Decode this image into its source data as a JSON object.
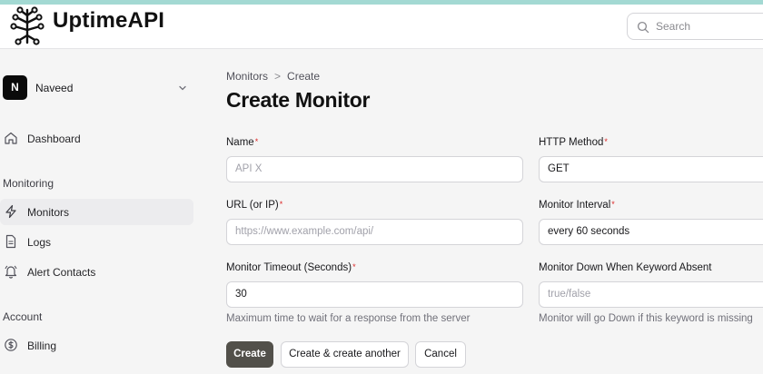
{
  "app": {
    "name": "UptimeAPI"
  },
  "search": {
    "placeholder": "Search"
  },
  "team": {
    "initial": "N",
    "name": "Naveed"
  },
  "sidebar": {
    "dashboard_label": "Dashboard",
    "monitoring_heading": "Monitoring",
    "monitors_label": "Monitors",
    "logs_label": "Logs",
    "alert_contacts_label": "Alert Contacts",
    "account_heading": "Account",
    "billing_label": "Billing"
  },
  "breadcrumb": {
    "parent": "Monitors",
    "separator": ">",
    "current": "Create"
  },
  "page": {
    "title": "Create Monitor"
  },
  "form": {
    "required_mark": "*",
    "name": {
      "label": "Name",
      "placeholder": "API X",
      "required": true
    },
    "http_method": {
      "label": "HTTP Method",
      "value": "GET",
      "required": true
    },
    "url": {
      "label": "URL (or IP)",
      "placeholder": "https://www.example.com/api/",
      "required": true
    },
    "interval": {
      "label": "Monitor Interval",
      "value": "every 60 seconds",
      "required": true
    },
    "timeout": {
      "label": "Monitor Timeout (Seconds)",
      "value": "30",
      "help": "Maximum time to wait for a response from the server",
      "required": true
    },
    "keyword": {
      "label": "Monitor Down When Keyword Absent",
      "placeholder": "true/false",
      "help": "Monitor will go Down if this keyword is missing",
      "required": false
    }
  },
  "actions": {
    "create_label": "Create",
    "create_another_label": "Create & create another",
    "cancel_label": "Cancel"
  },
  "colors": {
    "accent": "#52504a",
    "required": "#dc2626",
    "topstrip": "#a3d9d3",
    "active_nav": "#ececee"
  }
}
